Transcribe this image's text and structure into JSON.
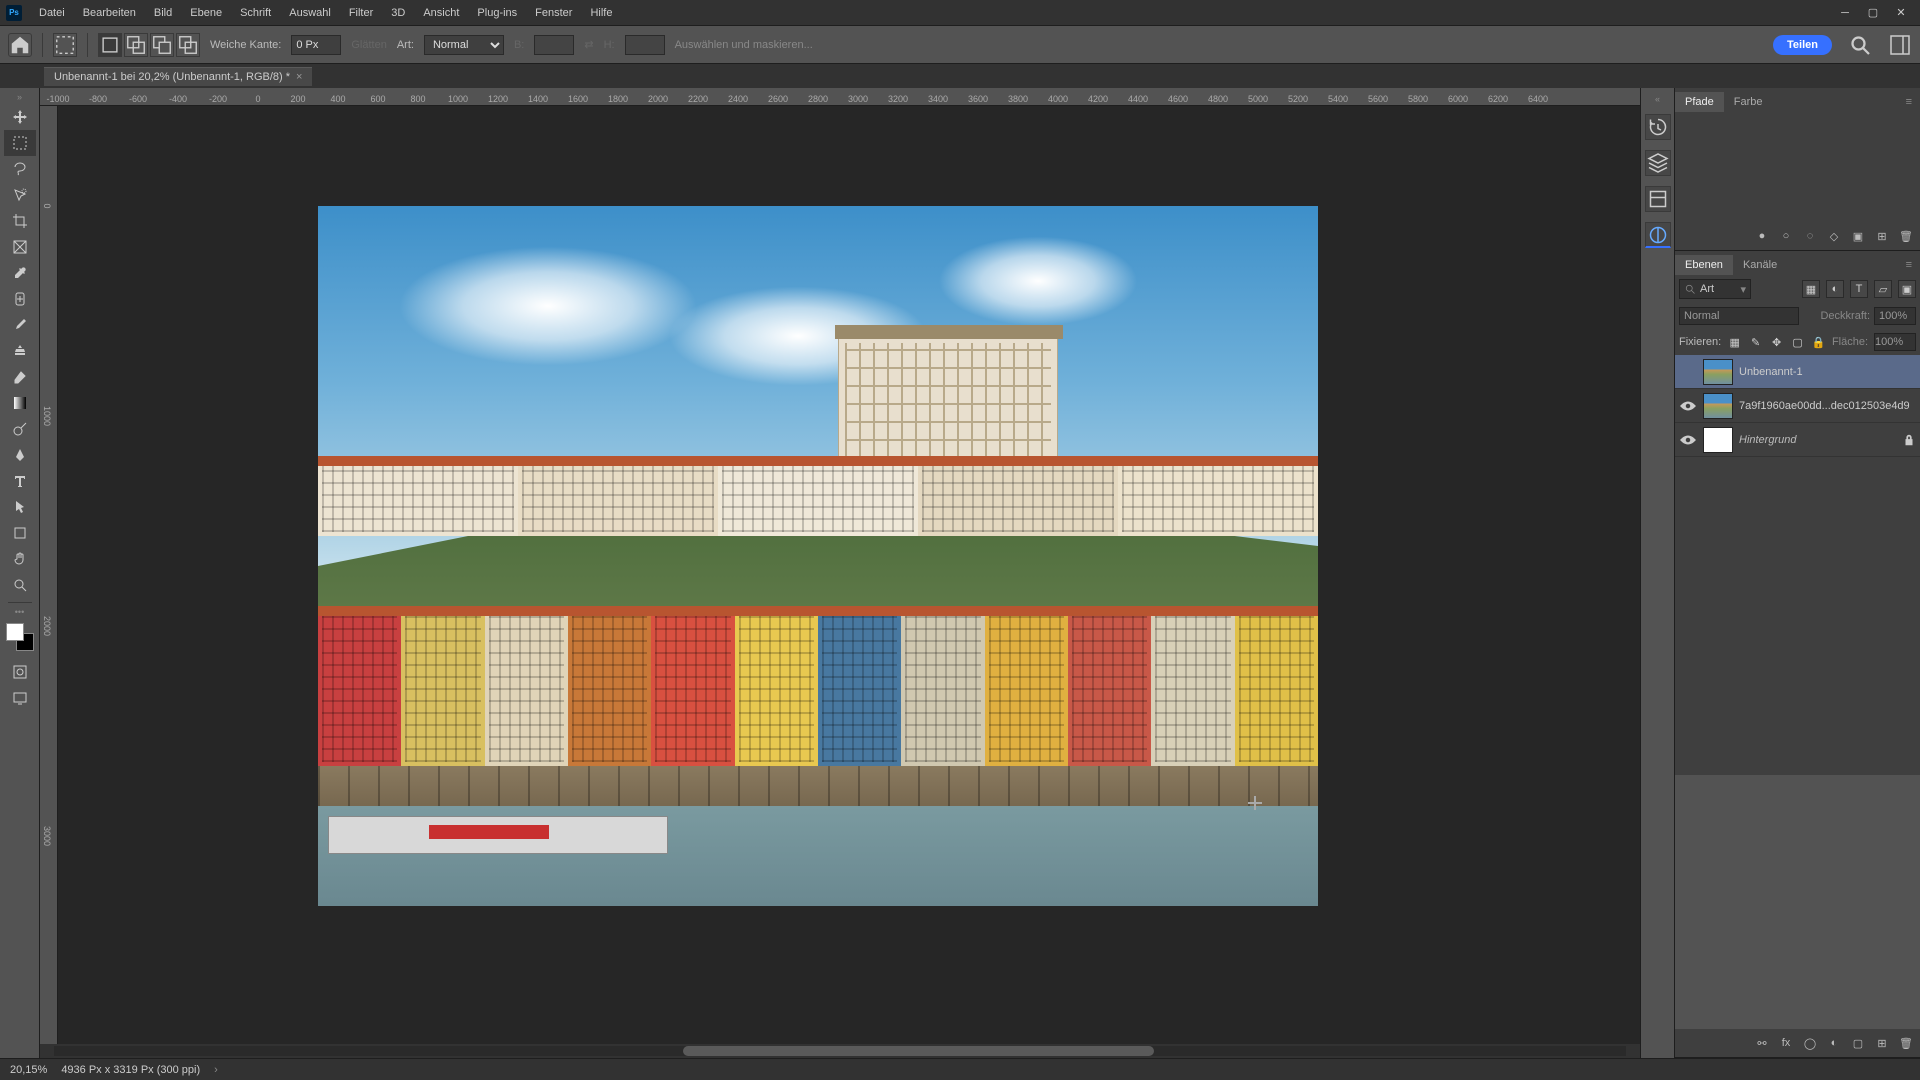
{
  "menubar": {
    "items": [
      "Datei",
      "Bearbeiten",
      "Bild",
      "Ebene",
      "Schrift",
      "Auswahl",
      "Filter",
      "3D",
      "Ansicht",
      "Plug-ins",
      "Fenster",
      "Hilfe"
    ]
  },
  "optionsbar": {
    "feather_label": "Weiche Kante:",
    "feather_value": "0 Px",
    "antialias_label": "Glätten",
    "style_label": "Art:",
    "style_value": "Normal",
    "width_label": "B:",
    "height_label": "H:",
    "select_mask": "Auswählen und maskieren...",
    "share": "Teilen"
  },
  "doc_tab": {
    "title": "Unbenannt-1 bei 20,2% (Unbenannt-1, RGB/8) *"
  },
  "ruler_marks": [
    "-1000",
    "-800",
    "-600",
    "-400",
    "-200",
    "0",
    "200",
    "400",
    "600",
    "800",
    "1000",
    "1200",
    "1400",
    "1600",
    "1800",
    "2000",
    "2200",
    "2400",
    "2600",
    "2800",
    "3000",
    "3200",
    "3400",
    "3600",
    "3800",
    "4000",
    "4200",
    "4400",
    "4600",
    "4800",
    "5000",
    "5200",
    "5400",
    "5600",
    "5800",
    "6000",
    "6200",
    "6400"
  ],
  "ruler_v": [
    "0",
    "1000",
    "2000",
    "3000"
  ],
  "panels": {
    "paths_tabs": [
      "Pfade",
      "Farbe"
    ],
    "layers_tabs": [
      "Ebenen",
      "Kanäle"
    ],
    "search_placeholder": "Art",
    "blend_mode": "Normal",
    "opacity_label": "Deckkraft:",
    "opacity_value": "100%",
    "lock_label": "Fixieren:",
    "fill_label": "Fläche:",
    "fill_value": "100%"
  },
  "layers": [
    {
      "name": "Unbenannt-1",
      "visible": false,
      "selected": true,
      "thumb": "img",
      "italic": false
    },
    {
      "name": "7a9f1960ae00dd...dec012503e4d9",
      "visible": true,
      "selected": false,
      "thumb": "img",
      "italic": false
    },
    {
      "name": "Hintergrund",
      "visible": true,
      "selected": false,
      "thumb": "white",
      "italic": true,
      "locked": true
    }
  ],
  "status": {
    "zoom": "20,15%",
    "doc_info": "4936 Px x 3319 Px (300 ppi)"
  },
  "colors": {
    "accent": "#3670ff"
  }
}
